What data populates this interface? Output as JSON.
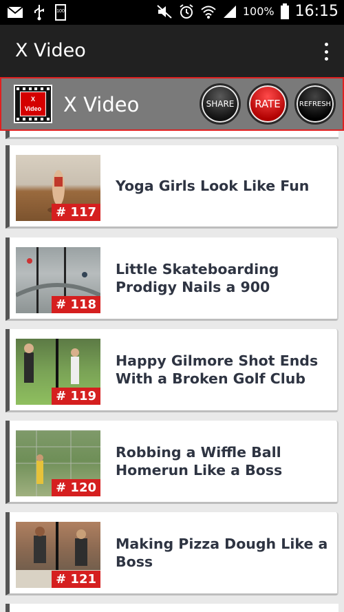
{
  "status_bar": {
    "battery_percent": "100%",
    "time": "16:15",
    "battery_small_label": "100"
  },
  "action_bar": {
    "title": "X Video"
  },
  "header": {
    "logo_text": "X\nVideo",
    "title": "X Video",
    "share_label": "SHARE",
    "rate_label": "RATE",
    "refresh_label": "REFRESH"
  },
  "videos": [
    {
      "number": "# 117",
      "title": "Yoga Girls Look Like Fun"
    },
    {
      "number": "# 118",
      "title": "Little Skateboarding Prodigy Nails a 900"
    },
    {
      "number": "# 119",
      "title": "Happy Gilmore Shot Ends With a Broken Golf Club"
    },
    {
      "number": "# 120",
      "title": "Robbing a Wiffle Ball Homerun Like a Boss"
    },
    {
      "number": "# 121",
      "title": "Making Pizza Dough Like a Boss"
    }
  ],
  "colors": {
    "accent_red": "#d51f1f",
    "action_bar": "#212121",
    "header_bg": "#7a7a7a",
    "title_text": "#2e3442"
  }
}
